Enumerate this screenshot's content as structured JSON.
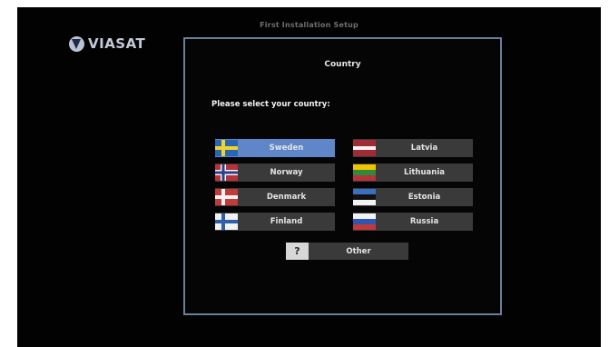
{
  "header": {
    "title": "First Installation Setup"
  },
  "brand": {
    "name": "VIASAT"
  },
  "dialog": {
    "title": "Country",
    "prompt": "Please select your country:",
    "countries": [
      {
        "label": "Sweden",
        "flag": "sweden-flag",
        "selected": true
      },
      {
        "label": "Norway",
        "flag": "norway-flag",
        "selected": false
      },
      {
        "label": "Denmark",
        "flag": "denmark-flag",
        "selected": false
      },
      {
        "label": "Finland",
        "flag": "finland-flag",
        "selected": false
      },
      {
        "label": "Latvia",
        "flag": "latvia-flag",
        "selected": false
      },
      {
        "label": "Lithuania",
        "flag": "lithuania-flag",
        "selected": false
      },
      {
        "label": "Estonia",
        "flag": "estonia-flag",
        "selected": false
      },
      {
        "label": "Russia",
        "flag": "russia-flag",
        "selected": false
      }
    ],
    "other": {
      "icon_text": "?",
      "label": "Other"
    }
  },
  "colors": {
    "selected": "#5f86c8",
    "button": "#3a3a3a",
    "panel_border": "#6c7f9a"
  }
}
